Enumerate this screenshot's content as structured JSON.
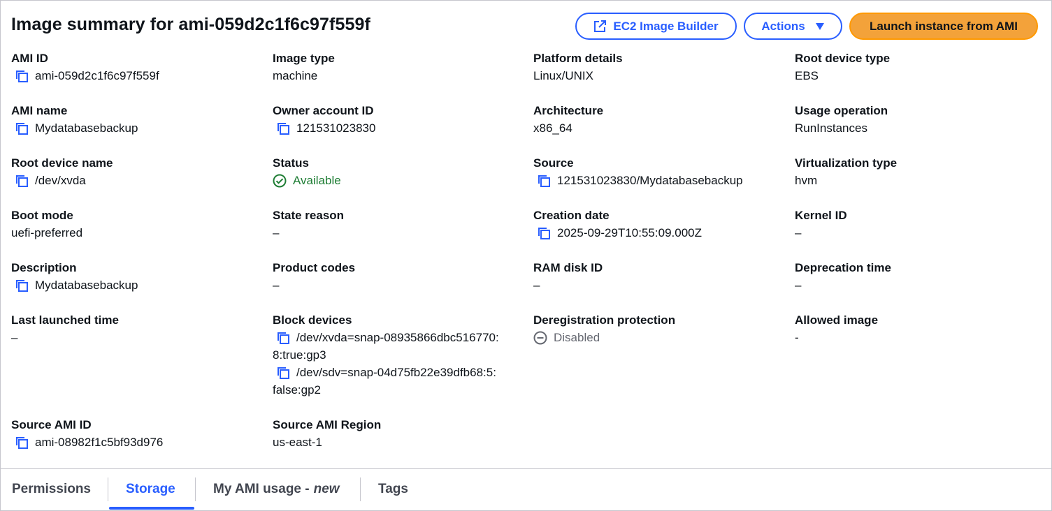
{
  "header": {
    "title": "Image summary for ami-059d2c1f6c97f559f",
    "builder_label": "EC2 Image Builder",
    "actions_label": "Actions",
    "launch_label": "Launch instance from AMI"
  },
  "colors": {
    "accent": "#295eff",
    "primary_button": "#f3a23a",
    "success": "#1e7d34",
    "muted": "#656871"
  },
  "fields": {
    "ami_id": {
      "label": "AMI ID",
      "value": "ami-059d2c1f6c97f559f"
    },
    "image_type": {
      "label": "Image type",
      "value": "machine"
    },
    "platform_details": {
      "label": "Platform details",
      "value": "Linux/UNIX"
    },
    "root_device_type": {
      "label": "Root device type",
      "value": "EBS"
    },
    "ami_name": {
      "label": "AMI name",
      "value": "Mydatabasebackup"
    },
    "owner_account_id": {
      "label": "Owner account ID",
      "value": "121531023830"
    },
    "architecture": {
      "label": "Architecture",
      "value": "x86_64"
    },
    "usage_operation": {
      "label": "Usage operation",
      "value": "RunInstances"
    },
    "root_device_name": {
      "label": "Root device name",
      "value": "/dev/xvda"
    },
    "status": {
      "label": "Status",
      "value": "Available"
    },
    "source": {
      "label": "Source",
      "value": "121531023830/Mydatabasebackup"
    },
    "virtualization_type": {
      "label": "Virtualization type",
      "value": "hvm"
    },
    "boot_mode": {
      "label": "Boot mode",
      "value": "uefi-preferred"
    },
    "state_reason": {
      "label": "State reason",
      "value": "–"
    },
    "creation_date": {
      "label": "Creation date",
      "value": "2025-09-29T10:55:09.000Z"
    },
    "kernel_id": {
      "label": "Kernel ID",
      "value": "–"
    },
    "description": {
      "label": "Description",
      "value": "Mydatabasebackup"
    },
    "product_codes": {
      "label": "Product codes",
      "value": "–"
    },
    "ram_disk_id": {
      "label": "RAM disk ID",
      "value": "–"
    },
    "deprecation_time": {
      "label": "Deprecation time",
      "value": "–"
    },
    "last_launched_time": {
      "label": "Last launched time",
      "value": "–"
    },
    "block_devices": {
      "label": "Block devices",
      "items": [
        {
          "line1": "/dev/xvda=snap-08935866dbc516770:",
          "line2": "8:true:gp3"
        },
        {
          "line1": "/dev/sdv=snap-04d75fb22e39dfb68:5:",
          "line2": "false:gp2"
        }
      ]
    },
    "deregistration_protection": {
      "label": "Deregistration protection",
      "value": "Disabled"
    },
    "allowed_image": {
      "label": "Allowed image",
      "value": "-"
    },
    "source_ami_id": {
      "label": "Source AMI ID",
      "value": "ami-08982f1c5bf93d976"
    },
    "source_ami_region": {
      "label": "Source AMI Region",
      "value": "us-east-1"
    }
  },
  "tabs": {
    "permissions": "Permissions",
    "storage": "Storage",
    "my_ami_usage": "My AMI usage -",
    "my_ami_usage_new": "new",
    "tags": "Tags",
    "active": "Storage"
  }
}
